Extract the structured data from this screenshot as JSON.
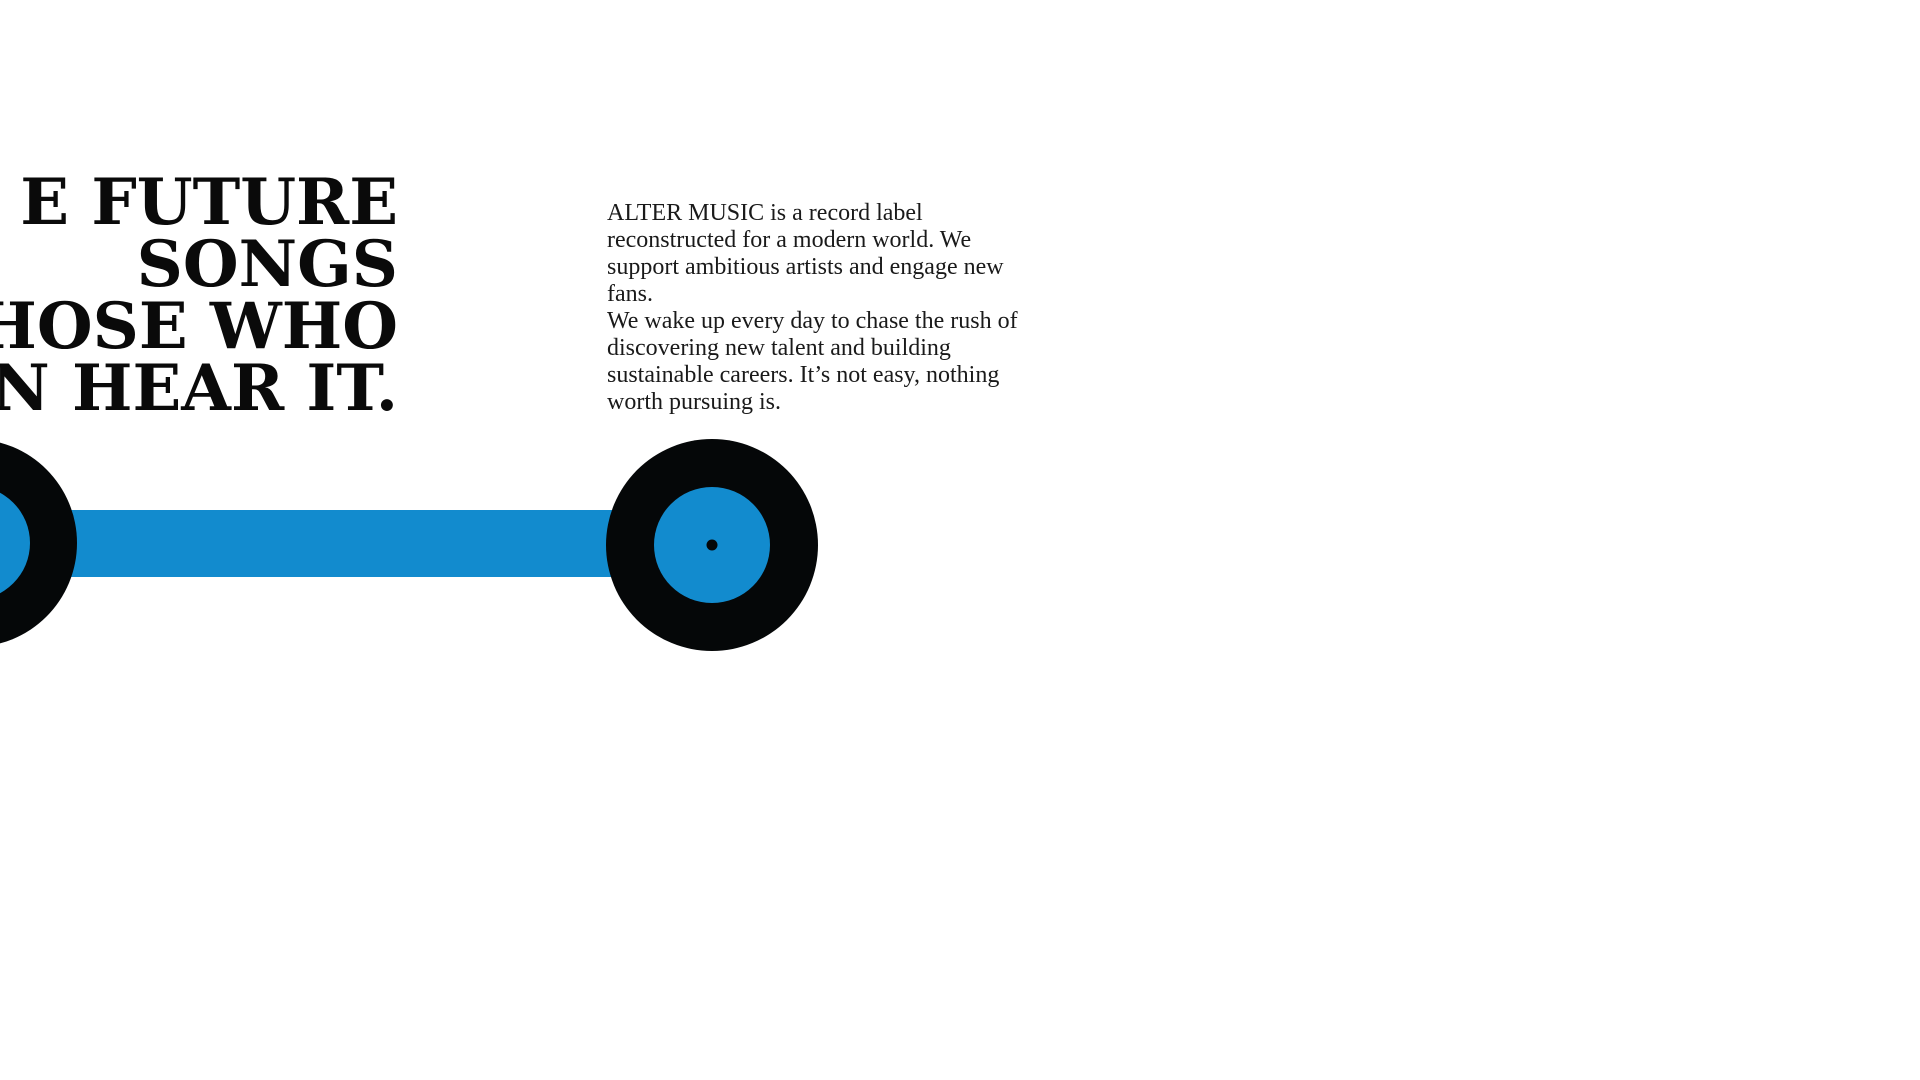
{
  "hero": {
    "headline_lines": [
      "E FUTURE",
      "SONGS",
      "THOSE WHO",
      "N HEAR IT."
    ]
  },
  "about": {
    "paragraphs": [
      "ALTER MUSIC is a record label reconstructed for a modern world. We support ambitious artists and engage new fans.",
      "We wake up every day to chase the rush of discovering new talent and building sustainable careers. It’s not easy, nothing worth pursuing is."
    ]
  },
  "graphic": {
    "icon_left": "vinyl-record-icon",
    "icon_right": "vinyl-record-icon",
    "connector": "blue-bar",
    "colors": {
      "vinyl": "#050708",
      "label": "#128bce",
      "bar": "#128bce",
      "spindle": "#050708"
    }
  }
}
